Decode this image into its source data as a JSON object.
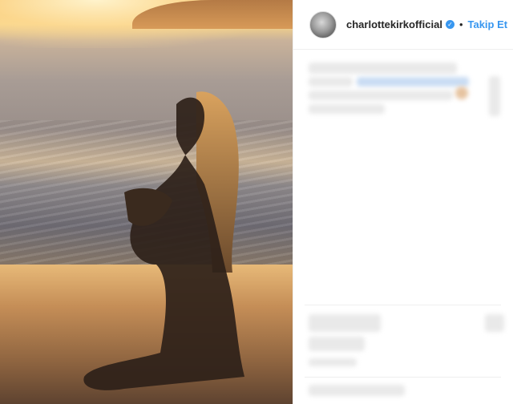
{
  "post": {
    "author": {
      "username": "charlottekirkofficial",
      "verified": true,
      "follow_label": "Takip Et",
      "separator": "•"
    }
  },
  "colors": {
    "accent": "#3897f0",
    "text": "#262626",
    "border": "#efefef"
  },
  "icons": {
    "verified": "verified-badge-icon"
  }
}
